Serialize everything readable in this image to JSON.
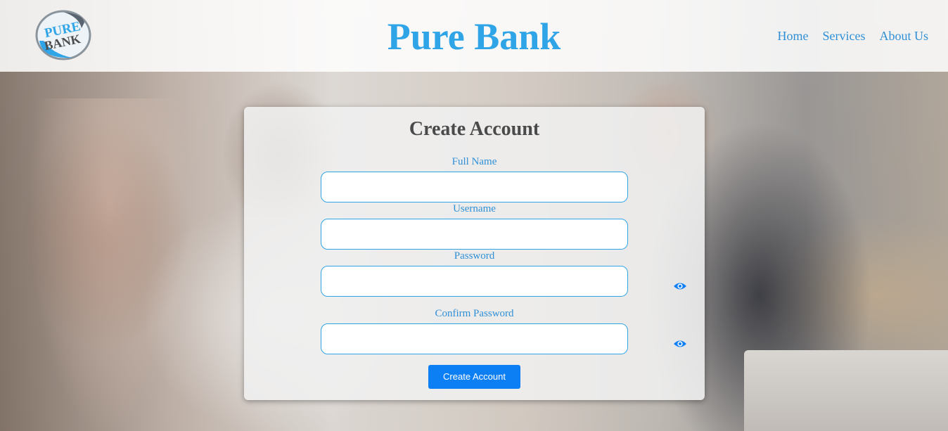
{
  "header": {
    "logo_text_top": "PURE",
    "logo_text_bottom": "BANK",
    "title": "Pure Bank",
    "nav": [
      {
        "label": "Home"
      },
      {
        "label": "Services"
      },
      {
        "label": "About Us"
      }
    ]
  },
  "form": {
    "title": "Create Account",
    "fields": [
      {
        "label": "Full Name",
        "value": "",
        "placeholder": ""
      },
      {
        "label": "Username",
        "value": "",
        "placeholder": ""
      },
      {
        "label": "Password",
        "value": "",
        "placeholder": ""
      },
      {
        "label": "Confirm Password",
        "value": "",
        "placeholder": ""
      }
    ],
    "submit_label": "Create Account"
  },
  "colors": {
    "brand_blue": "#2fa4e7",
    "link_blue": "#2f8fd6",
    "button_blue": "#0d7ff5",
    "title_gray": "#4a4a4a"
  },
  "icons": {
    "logo": "pure-bank-logo",
    "password_toggle": "eye-icon",
    "confirm_password_toggle": "eye-icon"
  }
}
